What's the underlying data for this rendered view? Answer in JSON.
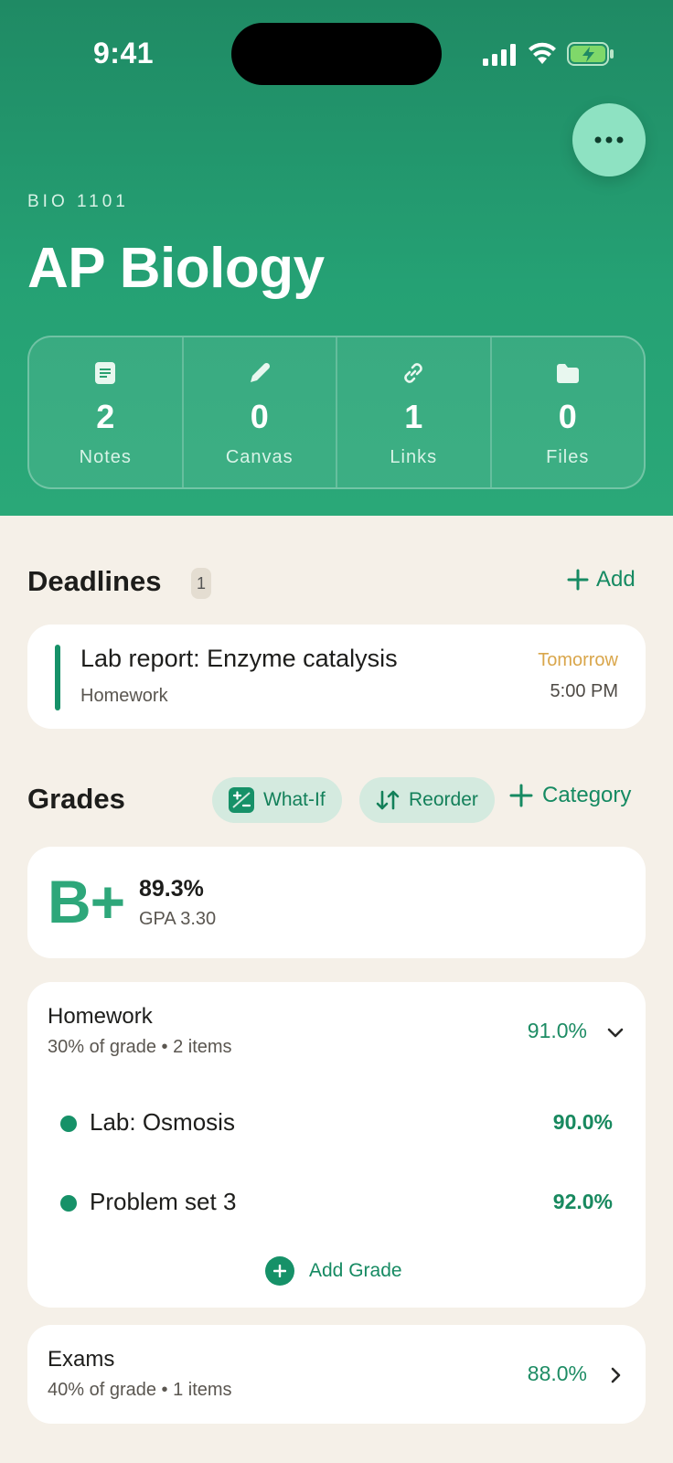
{
  "status_bar": {
    "time": "9:41"
  },
  "course": {
    "code": "BIO 1101",
    "title": "AP Biology"
  },
  "stats": [
    {
      "icon": "note-icon",
      "count": "2",
      "label": "Notes"
    },
    {
      "icon": "pencil-icon",
      "count": "0",
      "label": "Canvas"
    },
    {
      "icon": "link-icon",
      "count": "1",
      "label": "Links"
    },
    {
      "icon": "folder-icon",
      "count": "0",
      "label": "Files"
    }
  ],
  "deadlines": {
    "title": "Deadlines",
    "count": "1",
    "add_label": "Add",
    "items": [
      {
        "title": "Lab report: Enzyme catalysis",
        "category": "Homework",
        "when": "Tomorrow",
        "time": "5:00 PM"
      }
    ]
  },
  "grades": {
    "title": "Grades",
    "what_if_label": "What-If",
    "reorder_label": "Reorder",
    "category_label": "Category",
    "summary": {
      "letter": "B+",
      "percent": "89.3%",
      "gpa": "GPA 3.30"
    },
    "categories": [
      {
        "name": "Homework",
        "meta": "30% of grade • 2 items",
        "percent": "91.0%",
        "expanded": true,
        "items": [
          {
            "name": "Lab: Osmosis",
            "value": "90.0%"
          },
          {
            "name": "Problem set 3",
            "value": "92.0%"
          }
        ],
        "add_label": "Add Grade"
      },
      {
        "name": "Exams",
        "meta": "40% of grade • 1 items",
        "percent": "88.0%",
        "expanded": false
      }
    ]
  },
  "colors": {
    "header_green": "#1f8a64",
    "accent": "#169168",
    "warning": "#d9a64b",
    "background": "#f5f0e8"
  }
}
